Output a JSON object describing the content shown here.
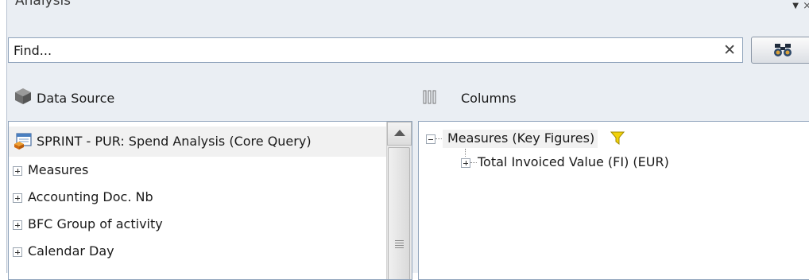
{
  "panel": {
    "title": "Analysis",
    "menu_arrow": "▼",
    "close_glyph": "×"
  },
  "search": {
    "placeholder": "",
    "value": "Find...",
    "clear_glyph": "✕"
  },
  "data_source": {
    "label": "Data Source",
    "root_label": "SPRINT - PUR: Spend Analysis (Core Query)",
    "items": [
      {
        "label": "Measures"
      },
      {
        "label": "Accounting Doc. Nb"
      },
      {
        "label": "BFC Group of activity"
      },
      {
        "label": "Calendar Day"
      }
    ]
  },
  "columns": {
    "label": "Columns",
    "measures_label": "Measures (Key Figures)",
    "child_label": "Total Invoiced Value (FI) (EUR)"
  },
  "colors": {
    "panel_bg": "#eaeef3",
    "border": "#8fa3bb",
    "filter_yellow": "#f2d20a",
    "selection_bg": "#f1f1f1"
  }
}
